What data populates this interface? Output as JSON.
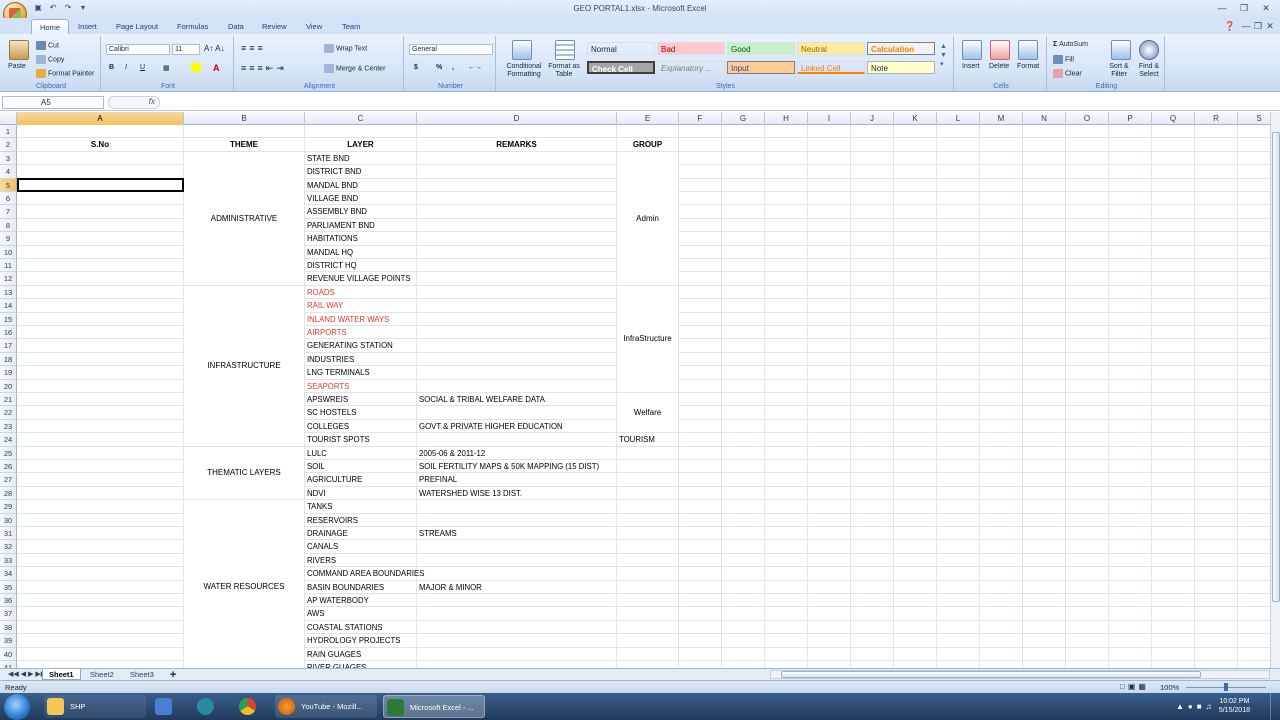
{
  "window": {
    "title": "GEO PORTAL1.xlsx - Microsoft Excel"
  },
  "quick_access": [
    "save-icon",
    "undo-icon",
    "redo-icon",
    "customize-icon"
  ],
  "tabs": [
    "Home",
    "Insert",
    "Page Layout",
    "Formulas",
    "Data",
    "Review",
    "View",
    "Team"
  ],
  "ribbon": {
    "clipboard": {
      "paste": "Paste",
      "cut": "Cut",
      "copy": "Copy",
      "format_painter": "Format Painter",
      "label": "Clipboard"
    },
    "font": {
      "name": "Calibri",
      "size": "11",
      "bold": "B",
      "italic": "I",
      "underline": "U",
      "label": "Font"
    },
    "alignment": {
      "wrap": "Wrap Text",
      "merge": "Merge & Center",
      "label": "Alignment"
    },
    "number": {
      "format": "General",
      "currency": "$",
      "percent": "%",
      "comma": ",",
      "label": "Number"
    },
    "styles": {
      "conditional": "Conditional Formatting",
      "format_table": "Format as Table",
      "items": [
        {
          "label": "Normal",
          "bg": "#ffffff",
          "fg": "#000000"
        },
        {
          "label": "Bad",
          "bg": "#ffc7ce",
          "fg": "#9c0006"
        },
        {
          "label": "Good",
          "bg": "#c6efce",
          "fg": "#006100"
        },
        {
          "label": "Neutral",
          "bg": "#ffeb9c",
          "fg": "#9c6500"
        },
        {
          "label": "Calculation",
          "bg": "#f2f2f2",
          "fg": "#fa7d00"
        },
        {
          "label": "Check Cell",
          "bg": "#a5a5a5",
          "fg": "#ffffff"
        },
        {
          "label": "Explanatory ...",
          "bg": "#ffffff",
          "fg": "#7f7f7f"
        },
        {
          "label": "Input",
          "bg": "#ffcc99",
          "fg": "#3f3f76"
        },
        {
          "label": "Linked Cell",
          "bg": "#ffffff",
          "fg": "#fa7d00"
        },
        {
          "label": "Note",
          "bg": "#ffffcc",
          "fg": "#000000"
        }
      ],
      "label": "Styles"
    },
    "cells": {
      "insert": "Insert",
      "delete": "Delete",
      "format": "Format",
      "label": "Cells"
    },
    "editing": {
      "autosum": "AutoSum",
      "fill": "Fill",
      "clear": "Clear",
      "sort": "Sort & Filter",
      "find": "Find & Select",
      "label": "Editing"
    }
  },
  "formula_bar": {
    "name_box": "A5",
    "fx": "fx",
    "content": ""
  },
  "columns": [
    "A",
    "B",
    "C",
    "D",
    "E",
    "F",
    "G",
    "H",
    "I",
    "J",
    "K",
    "L",
    "M",
    "N",
    "O",
    "P",
    "Q",
    "R",
    "S"
  ],
  "row_numbers": [
    "1",
    "2",
    "3",
    "4",
    "5",
    "6",
    "7",
    "8",
    "9",
    "10",
    "11",
    "12",
    "13",
    "14",
    "15",
    "16",
    "17",
    "18",
    "19",
    "20",
    "21",
    "22",
    "23",
    "24",
    "25",
    "26",
    "27",
    "28",
    "29",
    "30",
    "31",
    "32",
    "33",
    "34",
    "35",
    "36",
    "37",
    "38",
    "39",
    "40",
    "41"
  ],
  "headers": {
    "sno": "S.No",
    "theme": "THEME",
    "layer": "LAYER",
    "remarks": "REMARKS",
    "group": "GROUP"
  },
  "themes": {
    "administrative": "ADMINISTRATIVE",
    "infrastructure": "INFRASTRUCTURE",
    "thematic": "THEMATIC LAYERS",
    "water": "WATER RESOURCES"
  },
  "groups": {
    "admin": "Admin",
    "infra": "InfraStructure",
    "welfare": "Welfare",
    "tourism": "TOURISM"
  },
  "layers": [
    {
      "row": "3",
      "text": "STATE BND",
      "red": false
    },
    {
      "row": "4",
      "text": "DISTRICT BND",
      "red": false
    },
    {
      "row": "5",
      "text": "MANDAL BND",
      "red": false
    },
    {
      "row": "6",
      "text": "VILLAGE BND",
      "red": false
    },
    {
      "row": "7",
      "text": "ASSEMBLY BND",
      "red": false
    },
    {
      "row": "8",
      "text": "PARLIAMENT BND",
      "red": false
    },
    {
      "row": "9",
      "text": "HABITATIONS",
      "red": false
    },
    {
      "row": "10",
      "text": "MANDAL HQ",
      "red": false
    },
    {
      "row": "11",
      "text": "DISTRICT HQ",
      "red": false
    },
    {
      "row": "12",
      "text": "REVENUE VILLAGE POINTS",
      "red": false
    },
    {
      "row": "13",
      "text": "ROADS",
      "red": true
    },
    {
      "row": "14",
      "text": "RAIL WAY",
      "red": true
    },
    {
      "row": "15",
      "text": "INLAND WATER WAYS",
      "red": true
    },
    {
      "row": "16",
      "text": "AIRPORTS",
      "red": true
    },
    {
      "row": "17",
      "text": "GENERATING STATION",
      "red": false
    },
    {
      "row": "18",
      "text": "INDUSTRIES",
      "red": false
    },
    {
      "row": "19",
      "text": "LNG TERMINALS",
      "red": false
    },
    {
      "row": "20",
      "text": "SEAPORTS",
      "red": true
    },
    {
      "row": "21",
      "text": "APSWREIS",
      "red": false
    },
    {
      "row": "22",
      "text": "SC HOSTELS",
      "red": false
    },
    {
      "row": "23",
      "text": "COLLEGES",
      "red": false
    },
    {
      "row": "24",
      "text": "TOURIST SPOTS",
      "red": false
    },
    {
      "row": "25",
      "text": "LULC",
      "red": false
    },
    {
      "row": "26",
      "text": "SOIL",
      "red": false
    },
    {
      "row": "27",
      "text": "AGRICULTURE",
      "red": false
    },
    {
      "row": "28",
      "text": "NDVI",
      "red": false
    },
    {
      "row": "29",
      "text": "TANKS",
      "red": false
    },
    {
      "row": "30",
      "text": "RESERVOIRS",
      "red": false
    },
    {
      "row": "31",
      "text": "DRAINAGE",
      "red": false
    },
    {
      "row": "32",
      "text": "CANALS",
      "red": false
    },
    {
      "row": "33",
      "text": "RIVERS",
      "red": false
    },
    {
      "row": "34",
      "text": "COMMAND AREA BOUNDARIES",
      "red": false
    },
    {
      "row": "35",
      "text": "BASIN BOUNDARIES",
      "red": false
    },
    {
      "row": "36",
      "text": "AP WATERBODY",
      "red": false
    },
    {
      "row": "37",
      "text": "AWS",
      "red": false
    },
    {
      "row": "38",
      "text": "COASTAL STATIONS",
      "red": false
    },
    {
      "row": "39",
      "text": "HYDROLOGY PROJECTS",
      "red": false
    },
    {
      "row": "40",
      "text": "RAIN GUAGES",
      "red": false
    },
    {
      "row": "41",
      "text": "RIVER GUAGES",
      "red": false
    }
  ],
  "remarks": [
    {
      "row": "21",
      "text": "SOCIAL & TRIBAL WELFARE DATA"
    },
    {
      "row": "23",
      "text": "GOVT & PRIVATE HIGHER EDUCATION"
    },
    {
      "row": "25",
      "text": "2005-06 & 2011-12"
    },
    {
      "row": "26",
      "text": "SOIL FERTILITY MAPS & 50K MAPPING (15 DIST)"
    },
    {
      "row": "27",
      "text": "PREFINAL"
    },
    {
      "row": "28",
      "text": "WATERSHED WISE 13 DIST."
    },
    {
      "row": "31",
      "text": "STREAMS"
    },
    {
      "row": "35",
      "text": "MAJOR & MINOR"
    }
  ],
  "sheet_tabs": [
    "Sheet1",
    "Sheet2",
    "Sheet3"
  ],
  "status": {
    "ready": "Ready",
    "zoom": "100%"
  },
  "taskbar": {
    "items": [
      {
        "label": "SHP"
      },
      {
        "label": ""
      },
      {
        "label": ""
      },
      {
        "label": ""
      },
      {
        "label": "YouTube - Mozill..."
      },
      {
        "label": "Microsoft Excel - ..."
      }
    ],
    "time": "10:02 PM",
    "date": "5/15/2018"
  }
}
